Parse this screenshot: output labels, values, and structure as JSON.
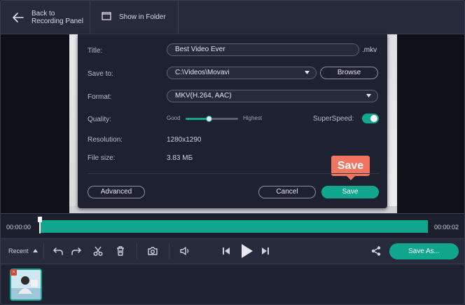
{
  "header": {
    "back_label": "Back to\nRecording Panel",
    "show_folder_label": "Show in Folder"
  },
  "dialog": {
    "title_label": "Title:",
    "title_value": "Best Video Ever",
    "title_ext": ".mkv",
    "saveto_label": "Save to:",
    "saveto_value": "C:\\Videos\\Movavi",
    "browse_label": "Browse",
    "format_label": "Format:",
    "format_value": "MKV(H.264, AAC)",
    "quality_label": "Quality:",
    "quality_low": "Good",
    "quality_high": "Highest",
    "quality_level": 0.45,
    "superspeed_label": "SuperSpeed:",
    "superspeed_on": true,
    "resolution_label": "Resolution:",
    "resolution_value": "1280x1290",
    "filesize_label": "File size:",
    "filesize_value": "3.83 МБ",
    "advanced_label": "Advanced",
    "cancel_label": "Cancel",
    "save_label": "Save",
    "callout_label": "Save"
  },
  "timeline": {
    "start_time": "00:00:00",
    "end_time": "00:00:02"
  },
  "controls": {
    "recent_label": "Recent",
    "save_as_label": "Save As..."
  },
  "colors": {
    "accent": "#12a68e",
    "callout": "#f27560",
    "background": "#232636"
  },
  "icons": [
    "back-arrow-icon",
    "folder-icon",
    "undo-icon",
    "redo-icon",
    "cut-icon",
    "delete-icon",
    "snapshot-icon",
    "volume-icon",
    "skip-back-icon",
    "play-icon",
    "skip-forward-icon",
    "share-icon"
  ]
}
